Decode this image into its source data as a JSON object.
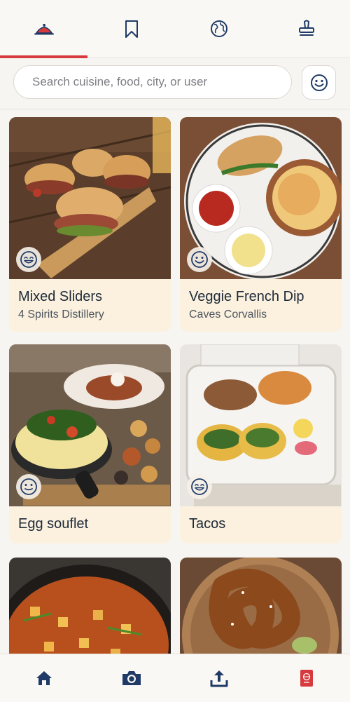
{
  "top_tabs": [
    {
      "icon": "food-cloche-icon"
    },
    {
      "icon": "bookmark-icon"
    },
    {
      "icon": "globe-icon"
    },
    {
      "icon": "stamp-icon"
    }
  ],
  "search": {
    "placeholder": "Search cuisine, food, city, or user",
    "filter_icon": "smiley-icon"
  },
  "feed": [
    {
      "title": "Mixed Sliders",
      "subtitle": "4 Spirits Distillery",
      "reaction": "grin-icon"
    },
    {
      "title": "Veggie French Dip",
      "subtitle": "Caves Corvallis",
      "reaction": "smiley-icon"
    },
    {
      "title": "Egg souflet",
      "subtitle": "",
      "reaction": "neutral-smile-icon"
    },
    {
      "title": "Tacos",
      "subtitle": "",
      "reaction": "grin-icon"
    },
    {
      "title": "",
      "subtitle": ""
    },
    {
      "title": "",
      "subtitle": ""
    }
  ],
  "bottom_nav": [
    {
      "icon": "home-icon"
    },
    {
      "icon": "camera-icon"
    },
    {
      "icon": "upload-icon"
    },
    {
      "icon": "passport-icon"
    }
  ],
  "colors": {
    "accent": "#d63a3d",
    "nav_icon": "#1f3a66",
    "card_bg": "#fbf1de"
  }
}
